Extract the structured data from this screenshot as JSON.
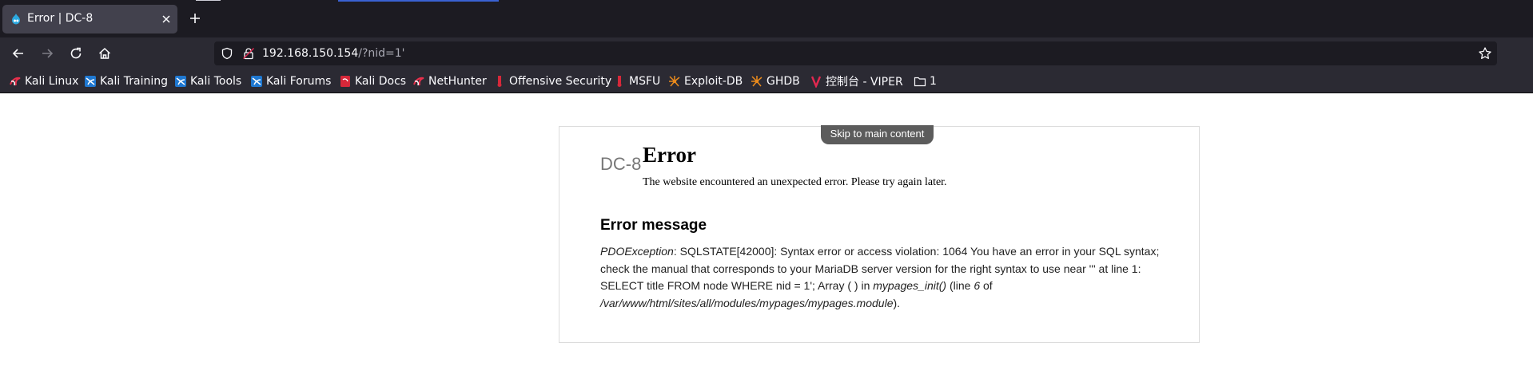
{
  "browser": {
    "tab": {
      "title": "Error | DC-8"
    },
    "url": {
      "host": "192.168.150.154",
      "path": "/?nid=1'"
    },
    "bookmarks": [
      {
        "label": "Kali Linux",
        "icon": "kali-dragon-icon"
      },
      {
        "label": "Kali Training",
        "icon": "kali-training-icon"
      },
      {
        "label": "Kali Tools",
        "icon": "kali-tools-icon"
      },
      {
        "label": "Kali Forums",
        "icon": "kali-forums-icon"
      },
      {
        "label": "Kali Docs",
        "icon": "kali-docs-icon"
      },
      {
        "label": "NetHunter",
        "icon": "nethunter-icon"
      },
      {
        "label": "Offensive Security",
        "icon": "offsec-icon"
      },
      {
        "label": "MSFU",
        "icon": "msfu-icon"
      },
      {
        "label": "Exploit-DB",
        "icon": "exploit-db-icon"
      },
      {
        "label": "GHDB",
        "icon": "ghdb-icon"
      },
      {
        "label": "控制台 - VIPER",
        "icon": "viper-icon"
      },
      {
        "label": "1",
        "icon": "folder-icon"
      }
    ]
  },
  "page": {
    "skip_link": "Skip to main content",
    "site_name": "DC-8",
    "title": "Error",
    "subtitle": "The website encountered an unexpected error. Please try again later.",
    "message_heading": "Error message",
    "message": {
      "exception": "PDOException",
      "text_1": ": SQLSTATE[42000]: Syntax error or access violation: 1064 You have an error in your SQL syntax; check the manual that corresponds to your MariaDB server version for the right syntax to use near ''' at line 1: SELECT title FROM node WHERE nid = 1'; Array ( ) in ",
      "function": "mypages_init()",
      "text_2": " (line ",
      "line": "6",
      "text_3": " of ",
      "file": "/var/www/html/sites/all/modules/mypages/mypages.module",
      "text_4": ")."
    }
  },
  "colors": {
    "tabbar_bg": "#1c1b22",
    "toolbar_bg": "#2b2a33",
    "active_tab": "#42414d",
    "text_light": "#fbfbfe",
    "skip_link_bg": "#5c5c5c"
  }
}
